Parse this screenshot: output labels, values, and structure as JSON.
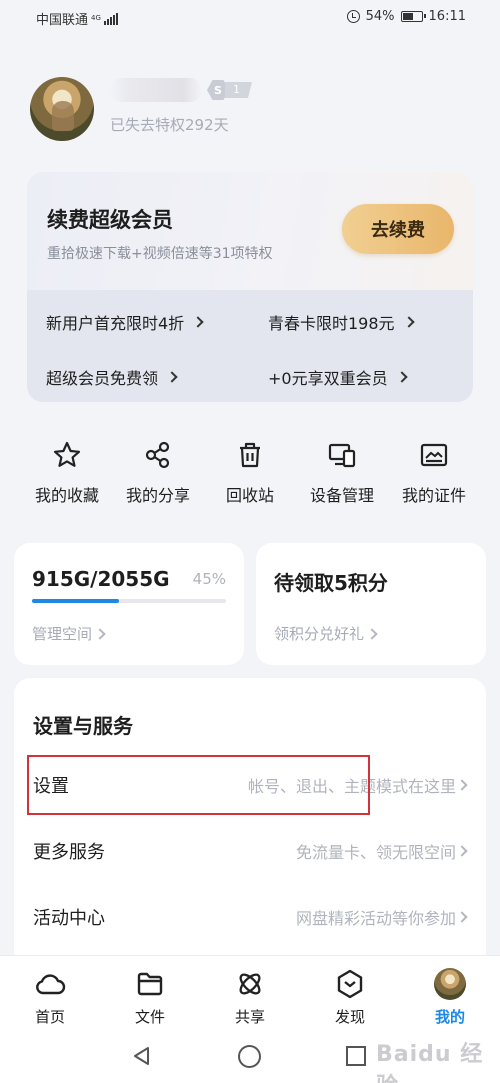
{
  "status_bar": {
    "carrier": "中国联通",
    "network": "4G",
    "battery": "54%",
    "time": "16:11"
  },
  "profile": {
    "vip_badge_letter": "S",
    "vip_level": "1",
    "status_text": "已失去特权292天"
  },
  "renew_card": {
    "title": "续费超级会员",
    "subtitle": "重拾极速下载+视频倍速等31项特权",
    "button": "去续费",
    "promos": [
      "新用户首充限时4折",
      "青春卡限时198元",
      "超级会员免费领",
      "+0元享双重会员"
    ]
  },
  "quick_actions": [
    {
      "label": "我的收藏",
      "icon": "star-icon"
    },
    {
      "label": "我的分享",
      "icon": "share-icon"
    },
    {
      "label": "回收站",
      "icon": "trash-icon"
    },
    {
      "label": "设备管理",
      "icon": "devices-icon"
    },
    {
      "label": "我的证件",
      "icon": "id-card-icon"
    }
  ],
  "storage": {
    "value": "915G/2055G",
    "percent": "45%",
    "used_fraction": 0.45,
    "link": "管理空间"
  },
  "points": {
    "title": "待领取5积分",
    "link": "领积分兑好礼"
  },
  "settings_section": {
    "title": "设置与服务",
    "rows": [
      {
        "label": "设置",
        "desc": "帐号、退出、主题模式在这里"
      },
      {
        "label": "更多服务",
        "desc": "免流量卡、领无限空间"
      },
      {
        "label": "活动中心",
        "desc": "网盘精彩活动等你参加"
      }
    ]
  },
  "tabs": [
    {
      "label": "首页",
      "icon": "cloud-icon"
    },
    {
      "label": "文件",
      "icon": "folder-icon"
    },
    {
      "label": "共享",
      "icon": "atom-icon"
    },
    {
      "label": "发现",
      "icon": "compass-hex-icon"
    },
    {
      "label": "我的",
      "icon": "avatar"
    }
  ],
  "watermark": "Baidu 经验",
  "colors": {
    "accent": "#1e88e5",
    "renew_button": "#e9b66b",
    "highlight_box": "#d3323a",
    "background": "#f3f4f8"
  }
}
